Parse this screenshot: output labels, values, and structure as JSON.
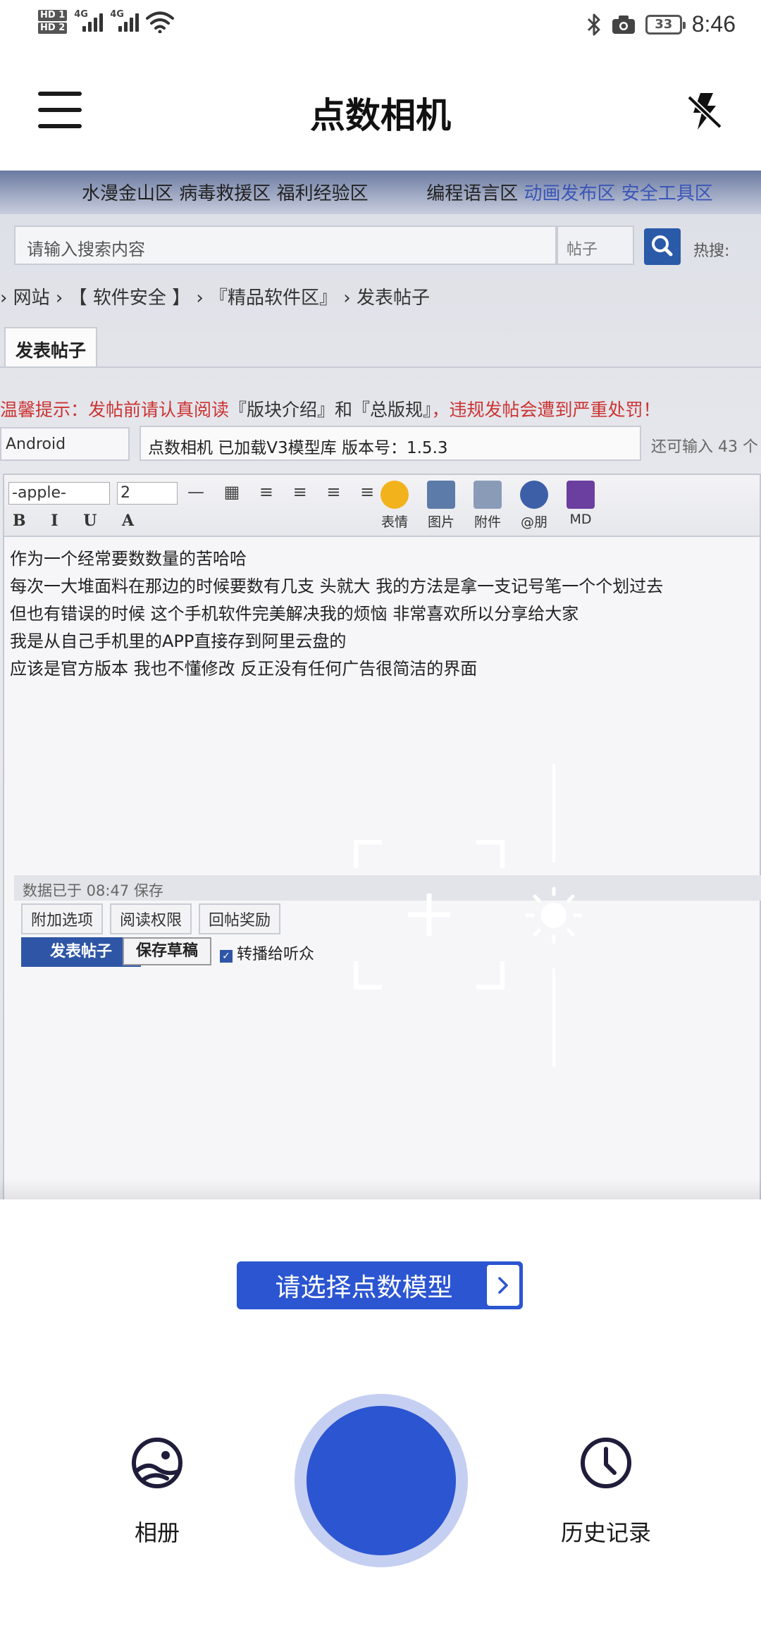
{
  "status_bar": {
    "hd1": "HD 1",
    "hd2": "HD 2",
    "net1": "4G",
    "net2": "4G",
    "battery": "33",
    "time": "8:46"
  },
  "app_bar": {
    "title": "点数相机",
    "menu_icon": "hamburger-menu-icon",
    "flash_icon": "flash-off-icon"
  },
  "preview": {
    "forum_nav": {
      "items": [
        "水漫金山区",
        "病毒救援区",
        "福利经验区"
      ],
      "more": "编程语言区",
      "blue1": "动画发布区",
      "blue2": "安全工具区"
    },
    "search_placeholder": "请输入搜索内容",
    "search_scope": "帖子",
    "hot_label": "热搜:",
    "breadcrumb": "›  网站  ›  【 软件安全 】 ›  『精品软件区』  ›  发表帖子",
    "tab": "发表帖子",
    "notice_red1": "温馨提示：发帖前请认真阅读",
    "notice_dark": "『版块介绍』和『总版规』",
    "notice_red2": "，违规发帖会遭到严重处罚！",
    "category": "Android",
    "title_input": "点数相机 已加载V3模型库 版本号：1.5.3",
    "remain": "还可输入 43 个",
    "font_select": "-apple-",
    "size_select": "2",
    "format_glyphs": "B I U A",
    "toolbar_labels": [
      "表情",
      "图片",
      "附件",
      "@朋",
      "MD"
    ],
    "body_lines": [
      "作为一个经常要数数量的苦哈哈",
      "每次一大堆面料在那边的时候要数有几支 头就大 我的方法是拿一支记号笔一个个划过去",
      "但也有错误的时候 这个手机软件完美解决我的烦恼 非常喜欢所以分享给大家",
      "我是从自己手机里的APP直接存到阿里云盘的",
      "应该是官方版本 我也不懂修改 反正没有任何广告很简洁的界面"
    ],
    "saved_text": "数据已于 08:47 保存",
    "options": [
      "附加选项",
      "阅读权限",
      "回帖奖励"
    ],
    "post_button": "发表帖子",
    "draft_button": "保存草稿",
    "broadcast_checkbox": "转播给听众"
  },
  "focus_icon": "focus-crosshair-icon",
  "brightness_icon": "brightness-sun-icon",
  "model_select": {
    "label": "请选择点数模型",
    "arrow_icon": "chevron-right-icon"
  },
  "bottom": {
    "album_label": "相册",
    "album_icon": "album-icon",
    "history_label": "历史记录",
    "history_icon": "clock-icon",
    "shutter_icon": "shutter-button"
  },
  "colors": {
    "accent": "#2B55D1",
    "shutter_ring": "#C5CFF2"
  }
}
